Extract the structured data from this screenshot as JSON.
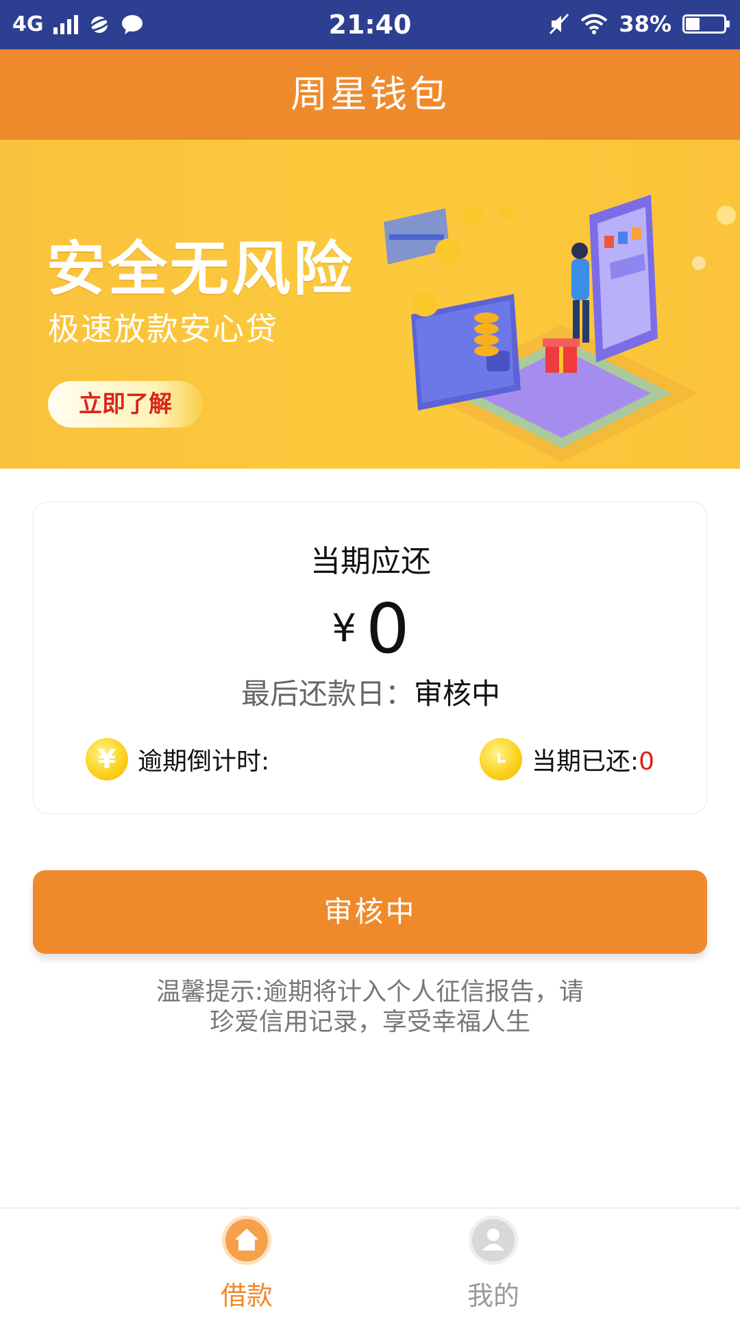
{
  "status_bar": {
    "network": "4G",
    "time": "21:40",
    "battery_percent": "38%",
    "battery_level": 0.38
  },
  "header": {
    "title": "周星钱包"
  },
  "banner": {
    "title": "安全无风险",
    "subtitle": "极速放款安心贷",
    "button_label": "立即了解"
  },
  "payment": {
    "title": "当期应还",
    "currency": "¥",
    "amount": "0",
    "due_label": "最后还款日：",
    "due_value": "审核中",
    "countdown_label": "逾期倒计时:",
    "paid_label": "当期已还:",
    "paid_value": "0"
  },
  "action": {
    "button_label": "审核中"
  },
  "tip": {
    "line1": "温馨提示:逾期将计入个人征信报告，请",
    "line2": "珍爱信用记录，享受幸福人生"
  },
  "bottom_nav": {
    "items": [
      {
        "label": "借款",
        "icon": "home-icon",
        "active": true
      },
      {
        "label": "我的",
        "icon": "user-icon",
        "active": false
      }
    ]
  },
  "colors": {
    "status_bar": "#2d3f91",
    "primary": "#ef8a2c",
    "banner": "#fbc43a",
    "accent_red": "#e11a1a"
  }
}
